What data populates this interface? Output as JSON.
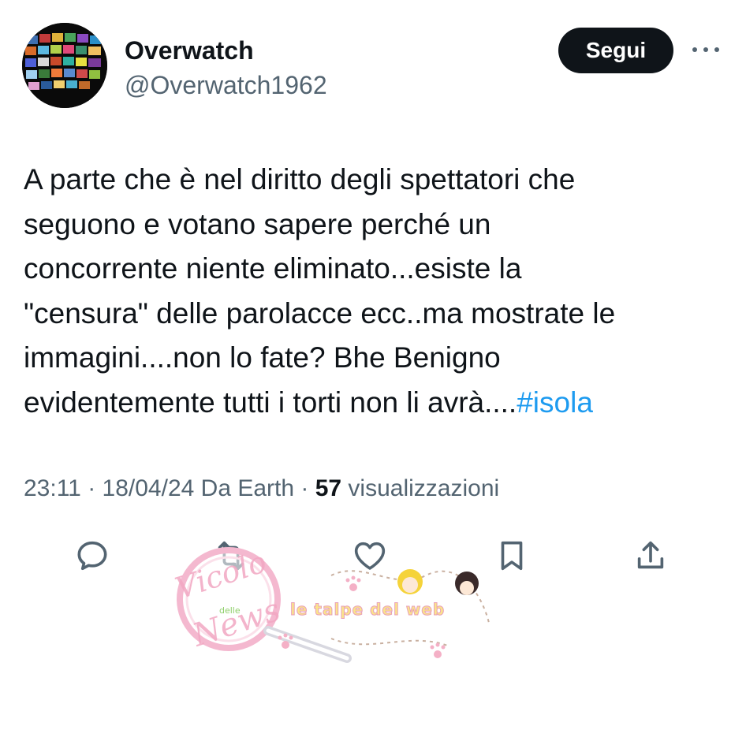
{
  "user": {
    "display_name": "Overwatch",
    "handle": "@Overwatch1962"
  },
  "header": {
    "follow_label": "Segui",
    "more_label": "···"
  },
  "tweet": {
    "line1": "A parte che è nel diritto degli spettatori che",
    "line2": "seguono e votano sapere perché un",
    "line3": "concorrente niente eliminato...esiste la",
    "line4": "\"censura\" delle parolacce ecc..ma mostrate le",
    "line5": "immagini....non lo fate? Bhe Benigno",
    "line6_text": "evidentemente tutti i torti non li avrà....",
    "hashtag": "#isola"
  },
  "meta": {
    "time": "23:11",
    "sep1": " · ",
    "date": "18/04/24",
    "source": " Da Earth",
    "sep2": " · ",
    "views_count": "57",
    "views_label": " visualizzazioni"
  },
  "actions": {
    "reply_icon": "reply-icon",
    "retweet_icon": "retweet-icon",
    "like_icon": "heart-icon",
    "bookmark_icon": "bookmark-icon",
    "share_icon": "share-icon"
  },
  "watermark": {
    "brand_line1": "Vicolo",
    "brand_line2": "delle",
    "brand_line3": "News",
    "tagline": "le talpe del web"
  },
  "colors": {
    "text_primary": "#0f1419",
    "text_secondary": "#536471",
    "link": "#1d9bf0",
    "follow_bg": "#0f1419",
    "icon": "#536471",
    "watermark_pink": "#f2a7c3",
    "watermark_yellow": "#f5d33a"
  }
}
